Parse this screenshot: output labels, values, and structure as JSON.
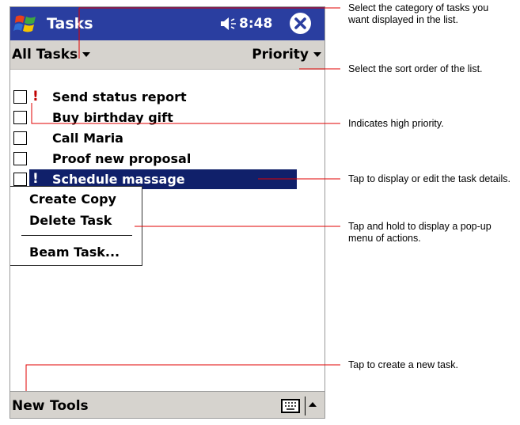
{
  "titlebar": {
    "app_title": "Tasks",
    "time": "8:48",
    "accent": "#2a3ea0"
  },
  "filter": {
    "category": "All Tasks",
    "sort": "Priority"
  },
  "tasks": [
    {
      "label": "Send status report",
      "priority": "!"
    },
    {
      "label": "Buy birthday gift",
      "priority": ""
    },
    {
      "label": "Call Maria",
      "priority": ""
    },
    {
      "label": "Proof new proposal",
      "priority": ""
    },
    {
      "label": "Schedule massage",
      "priority": "!"
    }
  ],
  "popup_menu": {
    "create_copy": "Create Copy",
    "delete_task": "Delete Task",
    "beam_task": "Beam Task..."
  },
  "menubar": {
    "new": "New",
    "tools": "Tools",
    "keyboard_icon": "keyboard-icon",
    "sip_arrow_icon": "chevron-up-icon"
  },
  "callouts": {
    "category": [
      "Select the category of tasks you",
      "want displayed in the list."
    ],
    "sort": "Select the sort order of the list.",
    "priority": "Indicates high priority.",
    "details": "Tap to display or edit the task details.",
    "popup": [
      "Tap and hold to display a pop-up",
      "menu of actions."
    ],
    "new_task": "Tap to create a new task."
  },
  "colors": {
    "title_bar": "#2a3ea0",
    "selection": "#10206a",
    "command_bar": "#d6d3ce",
    "priority_mark": "#c00000",
    "callout_line": "#e00000"
  }
}
